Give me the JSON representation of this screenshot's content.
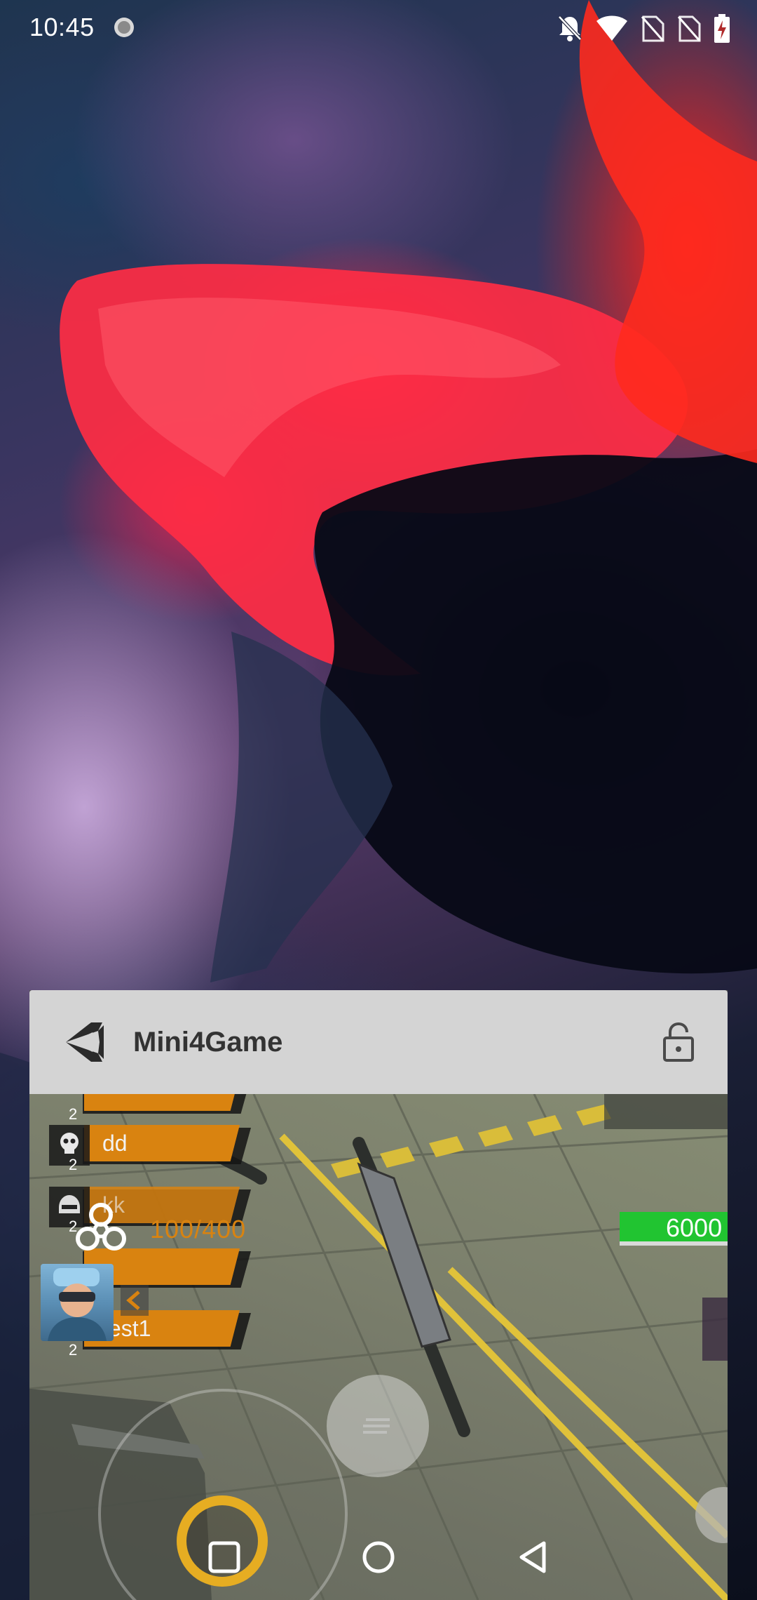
{
  "status_bar": {
    "time": "10:45",
    "icons": [
      "sync-icon",
      "notifications-off-icon",
      "wifi-icon",
      "no-sim-icon",
      "no-sim-icon",
      "battery-charging-icon"
    ]
  },
  "recent_app": {
    "name": "Mini4Game",
    "icon": "unity-logo-icon",
    "lock_icon": "lock-open-icon",
    "game": {
      "players": [
        {
          "name": "",
          "level": "2"
        },
        {
          "name": "dd",
          "level": "2"
        },
        {
          "name": "kk",
          "level": "2"
        },
        {
          "name": "",
          "level": "2"
        },
        {
          "name": "test1",
          "level": "2"
        }
      ],
      "health_text": "100/400",
      "score_text": "6000",
      "icons": [
        "biohazard-icon",
        "avatar",
        "back-chevron-icon",
        "chat-icon",
        "joystick"
      ]
    }
  },
  "navigation": {
    "recents": "square-icon",
    "home": "circle-icon",
    "back": "triangle-back-icon"
  },
  "colors": {
    "player_bar": "#d98310",
    "score_bar": "#21c431",
    "joystick": "#e6ad22",
    "card_header": "#d4d4d4"
  }
}
